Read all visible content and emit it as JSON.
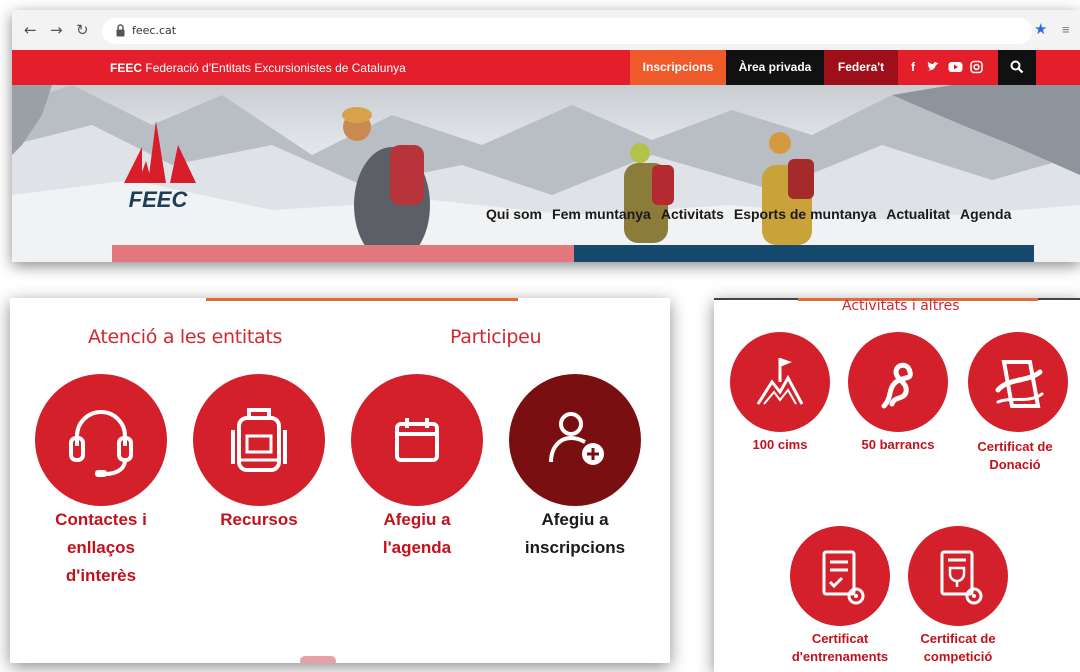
{
  "browser": {
    "url": "feec.cat",
    "back_icon": "arrow-left-icon",
    "forward_icon": "arrow-right-icon",
    "reload_icon": "reload-icon",
    "star_color": "#2a6ee0"
  },
  "topbar": {
    "brand_bold": "FEEC",
    "brand_text": "Federació d'Entitats Excursionistes de Catalunya",
    "inscripcions": "Inscripcions",
    "area_privada": "Àrea privada",
    "federat": "Federa't",
    "social_icons": [
      "facebook-icon",
      "twitter-icon",
      "youtube-icon",
      "instagram-icon"
    ],
    "search_icon": "search-icon",
    "colors": {
      "bar": "#e41e2b",
      "inscripcions": "#ee5a2a",
      "area": "#111111",
      "federat": "#9d0f19"
    }
  },
  "hero": {
    "logo_text": "FEEC",
    "nav": [
      "Qui som",
      "Fem muntanya",
      "Activitats",
      "Esports de muntanya",
      "Actualitat",
      "Agenda"
    ]
  },
  "left_card": {
    "heading_left": "Atenció a les entitats",
    "heading_right": "Participeu",
    "items": [
      {
        "icon": "headset-icon",
        "label": [
          "Contactes i",
          "enllaços",
          "d'interès"
        ]
      },
      {
        "icon": "backpack-icon",
        "label": [
          "Recursos"
        ]
      },
      {
        "icon": "calendar-icon",
        "label": [
          "Afegiu a",
          "l'agenda"
        ]
      },
      {
        "icon": "user-add-icon",
        "label": [
          "Afegiu a",
          "inscripcions"
        ]
      }
    ],
    "colors": {
      "accent": "#d3202b",
      "dark_accent": "#7a0f12",
      "label": "#c1121d"
    }
  },
  "right_card": {
    "heading": "Activitats i altres",
    "items": [
      {
        "icon": "mountain-flag-icon",
        "label": [
          "100 cims"
        ]
      },
      {
        "icon": "rope-knot-icon",
        "label": [
          "50 barrancs"
        ]
      },
      {
        "icon": "donation-icon",
        "label": [
          "Certificat de",
          "Donació"
        ]
      },
      {
        "icon": "certificate-icon",
        "label": [
          "Certificat",
          "d'entrenaments"
        ]
      },
      {
        "icon": "trophy-certificate-icon",
        "label": [
          "Certificat de",
          "competició"
        ]
      }
    ]
  }
}
